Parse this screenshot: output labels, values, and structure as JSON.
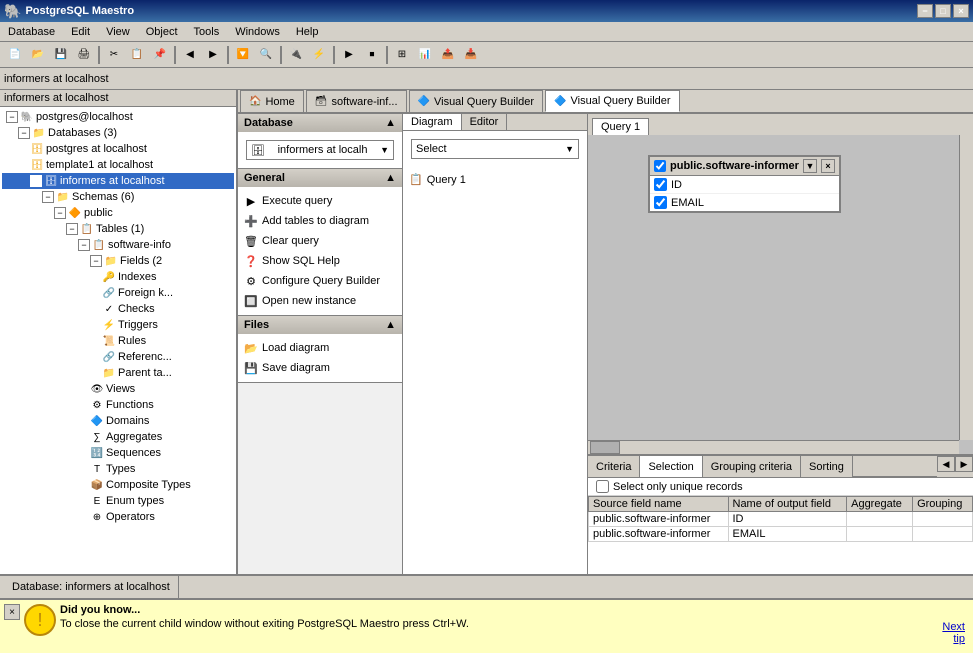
{
  "titleBar": {
    "title": "PostgreSQL Maestro",
    "icon": "🐘",
    "controls": [
      "−",
      "□",
      "×"
    ]
  },
  "menuBar": {
    "items": [
      "Database",
      "Edit",
      "View",
      "Object",
      "Tools",
      "Windows",
      "Help"
    ]
  },
  "addressBar": {
    "label": "informers at localhost"
  },
  "tabs": [
    {
      "id": "home",
      "label": "Home",
      "icon": "🏠",
      "active": false
    },
    {
      "id": "software-inf",
      "label": "software-inf...",
      "icon": "🗃",
      "active": false
    },
    {
      "id": "vqb1",
      "label": "Visual Query Builder",
      "icon": "🔷",
      "active": false
    },
    {
      "id": "vqb2",
      "label": "Visual Query Builder",
      "icon": "🔷",
      "active": true
    }
  ],
  "treePanel": {
    "title": "informers at localhost",
    "items": [
      {
        "level": 0,
        "expand": "−",
        "icon": "🐘",
        "label": "postgres@localhost",
        "type": "server"
      },
      {
        "level": 1,
        "expand": "−",
        "icon": "📁",
        "label": "Databases (3)",
        "type": "folder"
      },
      {
        "level": 2,
        "icon": "🗄",
        "label": "postgres at localhost",
        "type": "db"
      },
      {
        "level": 2,
        "icon": "🗄",
        "label": "template1 at localhost",
        "type": "db"
      },
      {
        "level": 2,
        "expand": "−",
        "icon": "🗄",
        "label": "informers at localhost",
        "type": "db",
        "active": true
      },
      {
        "level": 3,
        "expand": "−",
        "icon": "📁",
        "label": "Schemas (6)",
        "type": "folder"
      },
      {
        "level": 4,
        "expand": "−",
        "icon": "🔶",
        "label": "public",
        "type": "schema"
      },
      {
        "level": 5,
        "expand": "−",
        "icon": "📋",
        "label": "Tables (1)",
        "type": "folder"
      },
      {
        "level": 6,
        "expand": "−",
        "icon": "📋",
        "label": "software-info",
        "type": "table"
      },
      {
        "level": 7,
        "expand": "−",
        "icon": "📁",
        "label": "Fields (2",
        "type": "folder"
      },
      {
        "level": 8,
        "icon": "🔑",
        "label": "Indexes",
        "type": "indexes"
      },
      {
        "level": 8,
        "icon": "🔗",
        "label": "Foreign k...",
        "type": "foreignkeys"
      },
      {
        "level": 8,
        "icon": "✓",
        "label": "Checks",
        "type": "checks"
      },
      {
        "level": 8,
        "icon": "⚡",
        "label": "Triggers",
        "type": "triggers"
      },
      {
        "level": 8,
        "icon": "📜",
        "label": "Rules",
        "type": "rules"
      },
      {
        "level": 8,
        "icon": "🔗",
        "label": "Referenc...",
        "type": "references"
      },
      {
        "level": 8,
        "icon": "📁",
        "label": "Parent ta...",
        "type": "parent"
      },
      {
        "level": 5,
        "icon": "👁",
        "label": "Views",
        "type": "views"
      },
      {
        "level": 5,
        "icon": "⚙",
        "label": "Functions",
        "type": "functions"
      },
      {
        "level": 5,
        "icon": "🔷",
        "label": "Domains",
        "type": "domains"
      },
      {
        "level": 5,
        "icon": "∑",
        "label": "Aggregates",
        "type": "aggregates"
      },
      {
        "level": 5,
        "icon": "🔢",
        "label": "Sequences",
        "type": "sequences"
      },
      {
        "level": 5,
        "icon": "T",
        "label": "Types",
        "type": "types"
      },
      {
        "level": 5,
        "icon": "📦",
        "label": "Composite Types",
        "type": "composite"
      },
      {
        "level": 5,
        "icon": "E",
        "label": "Enum types",
        "type": "enumtypes"
      },
      {
        "level": 5,
        "icon": "⊕",
        "label": "Operators",
        "type": "operators"
      }
    ]
  },
  "middlePanel": {
    "database": {
      "title": "Database",
      "dropdown": "informers at localh"
    },
    "general": {
      "title": "General",
      "actions": [
        {
          "icon": "▶",
          "label": "Execute query"
        },
        {
          "icon": "➕",
          "label": "Add tables to diagram"
        },
        {
          "icon": "🗑",
          "label": "Clear query"
        },
        {
          "icon": "❓",
          "label": "Show SQL Help"
        },
        {
          "icon": "⚙",
          "label": "Configure Query Builder"
        },
        {
          "icon": "🔲",
          "label": "Open new instance"
        }
      ]
    },
    "files": {
      "title": "Files",
      "actions": [
        {
          "icon": "📂",
          "label": "Load diagram"
        },
        {
          "icon": "💾",
          "label": "Save diagram"
        }
      ]
    }
  },
  "diagramPanel": {
    "tabs": [
      "Diagram",
      "Editor"
    ],
    "activeTab": "Diagram",
    "selectLabel": "Select",
    "queries": [
      "Query 1"
    ]
  },
  "queryCanvas": {
    "activeQuery": "Query 1",
    "table": {
      "name": "public.software-informer",
      "fields": [
        {
          "checked": true,
          "name": "ID"
        },
        {
          "checked": true,
          "name": "EMAIL"
        }
      ]
    }
  },
  "resultsTabs": [
    {
      "label": "Criteria",
      "active": false
    },
    {
      "label": "Selection",
      "active": true
    },
    {
      "label": "Grouping criteria",
      "active": false
    },
    {
      "label": "Sorting",
      "active": false
    }
  ],
  "resultsData": {
    "checkboxLabel": "Select only unique records",
    "columns": [
      "Source field name",
      "Name of output field",
      "Aggregate",
      "Grouping"
    ],
    "rows": [
      [
        "public.software-informer",
        "ID",
        "",
        ""
      ],
      [
        "public.software-informer",
        "EMAIL",
        "",
        ""
      ]
    ]
  },
  "statusBar": {
    "text": "Database: informers at localhost"
  },
  "infoBar": {
    "title": "Did you know...",
    "body": "To close the current child window without exiting PostgreSQL Maestro press Ctrl+W.",
    "nextLabel": "Next\ntip"
  }
}
